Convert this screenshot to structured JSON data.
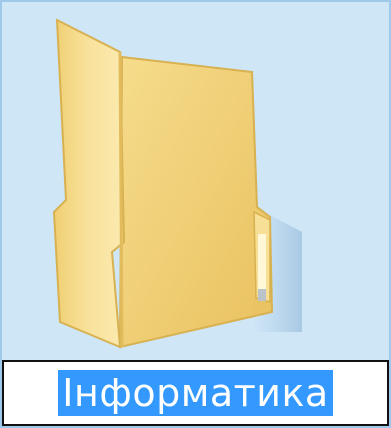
{
  "folder": {
    "name": "Інформатика",
    "icon": "folder-icon",
    "state": "selected-rename"
  },
  "colors": {
    "selection_background": "#cfe6f7",
    "selection_border": "#9fc9ea",
    "text_highlight": "#3399ff",
    "text_highlight_fg": "#ffffff",
    "folder_back": "#f2d27a",
    "folder_front": "#f9e5a3"
  }
}
